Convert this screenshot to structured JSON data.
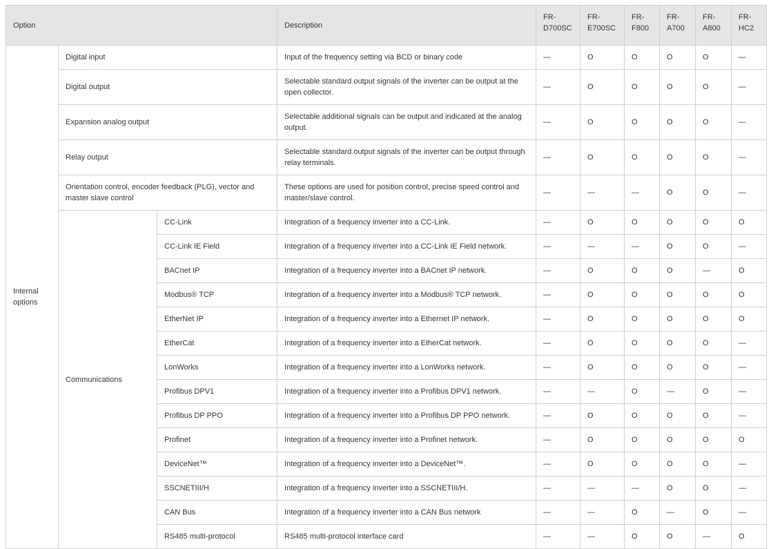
{
  "header": {
    "option": "Option",
    "description": "Description",
    "models": [
      [
        "FR-",
        "D700SC"
      ],
      [
        "FR-",
        "E700SC"
      ],
      [
        "FR-",
        "F800"
      ],
      [
        "FR-",
        "A700"
      ],
      [
        "FR-",
        "A800"
      ],
      [
        "FR-",
        "HC2"
      ]
    ]
  },
  "group_label_line1": "Internal",
  "group_label_line2": "options",
  "sub_group": "Communications",
  "rows": [
    {
      "option": "Digital input",
      "description": "Input of the frequency setting via BCD or binary code",
      "support": [
        "—",
        "O",
        "O",
        "O",
        "O",
        "—"
      ]
    },
    {
      "option": "Digital output",
      "description": "Selectable standard output signals of the inverter can be output at the open collector.",
      "support": [
        "—",
        "O",
        "O",
        "O",
        "O",
        "—"
      ]
    },
    {
      "option": "Expansion analog output",
      "description": "Selectable additional signals can be output and indicated at the analog output.",
      "support": [
        "—",
        "O",
        "O",
        "O",
        "O",
        "—"
      ]
    },
    {
      "option": "Relay output",
      "description": "Selectable standard output signals of the inverter can be output through relay terminals.",
      "support": [
        "—",
        "O",
        "O",
        "O",
        "O",
        "—"
      ]
    },
    {
      "option": "Orientation control, encoder feedback (PLG), vector and master slave control",
      "description": "These options are used for position control, precise speed control and master/slave control.",
      "support": [
        "—",
        "—",
        "—",
        "O",
        "O",
        "—"
      ]
    },
    {
      "option": "CC-Link",
      "description": "Integration of a frequency inverter into a CC-Link.",
      "support": [
        "—",
        "O",
        "O",
        "O",
        "O",
        "O"
      ]
    },
    {
      "option": "CC-Link IE Field",
      "description": "Integration of a frequency inverter into a CC-Link IE Field network.",
      "support": [
        "—",
        "—",
        "—",
        "O",
        "O",
        "—"
      ]
    },
    {
      "option": "BACnet IP",
      "description": "Integration of a frequency inverter into a BACnet IP network.",
      "support": [
        "—",
        "O",
        "O",
        "O",
        "—",
        "O"
      ]
    },
    {
      "option": "Modbus® TCP",
      "description": "Integration of a frequency inverter into a Modbus® TCP network.",
      "support": [
        "—",
        "O",
        "O",
        "O",
        "O",
        "O"
      ]
    },
    {
      "option": "EtherNet IP",
      "description": "Integration of a frequency inverter into a Ethernet IP network.",
      "support": [
        "—",
        "O",
        "O",
        "O",
        "O",
        "O"
      ]
    },
    {
      "option": "EtherCat",
      "description": "Integration of a frequency inverter into a EtherCat network.",
      "support": [
        "—",
        "O",
        "O",
        "O",
        "O",
        "—"
      ]
    },
    {
      "option": "LonWorks",
      "description": "Integration of a frequency inverter into a LonWorks network.",
      "support": [
        "—",
        "O",
        "O",
        "O",
        "O",
        "—"
      ]
    },
    {
      "option": "Profibus DPV1",
      "description": "Integration of a frequency inverter into a Profibus DPV1 network.",
      "support": [
        "—",
        "—",
        "O",
        "—",
        "O",
        "—"
      ]
    },
    {
      "option": "Profibus DP PPO",
      "description": "Integration of a frequency inverter into a Profibus DP PPO network.",
      "support": [
        "—",
        "O",
        "O",
        "O",
        "O",
        "—"
      ]
    },
    {
      "option": "Profinet",
      "description": "Integration of a frequency inverter into a Profinet network.",
      "support": [
        "—",
        "O",
        "O",
        "O",
        "O",
        "O"
      ]
    },
    {
      "option": "DeviceNet™",
      "description": "Integration of a frequency inverter into a DeviceNet™.",
      "support": [
        "—",
        "O",
        "O",
        "O",
        "O",
        "—"
      ]
    },
    {
      "option": "SSCNETIII/H",
      "description": "Integration of a frequency inverter into a SSCNETIII/H.",
      "support": [
        "—",
        "—",
        "—",
        "O",
        "O",
        "—"
      ]
    },
    {
      "option": "CAN Bus",
      "description": "Integration of a frequency inverter into a CAN Bus network",
      "support": [
        "—",
        "—",
        "O",
        "—",
        "O",
        "—"
      ]
    },
    {
      "option": "RS485 multi-protocol",
      "description": "RS485 multi-protocol interface card",
      "support": [
        "—",
        "—",
        "O",
        "O",
        "—",
        "O"
      ]
    }
  ]
}
